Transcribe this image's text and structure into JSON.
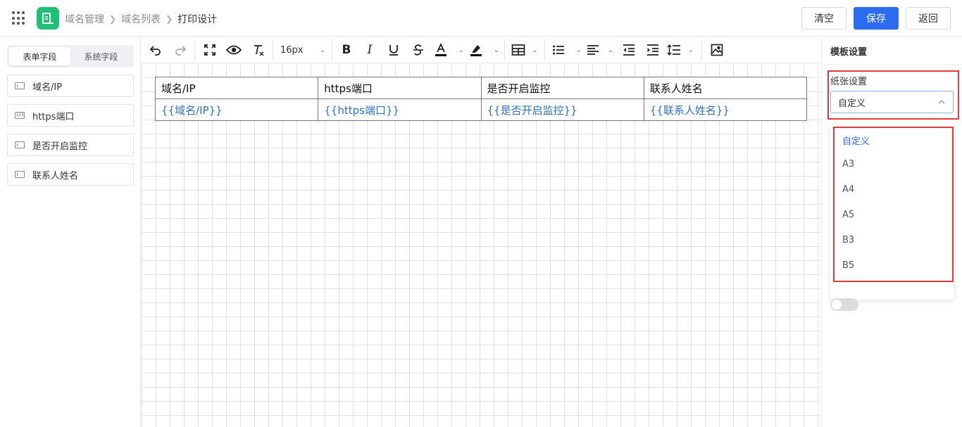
{
  "header": {
    "breadcrumb": [
      "域名管理",
      "域名列表",
      "打印设计"
    ],
    "buttons": {
      "clear": "清空",
      "save": "保存",
      "back": "返回"
    }
  },
  "left_panel": {
    "tabs": [
      "表单字段",
      "系统字段"
    ],
    "active_tab": 0,
    "fields": [
      {
        "label": "域名/IP",
        "icon": "text-field-icon"
      },
      {
        "label": "https端口",
        "icon": "number-field-icon",
        "icon_text": "123"
      },
      {
        "label": "是否开启监控",
        "icon": "text-field-icon"
      },
      {
        "label": "联系人姓名",
        "icon": "text-field-icon"
      }
    ]
  },
  "toolbar": {
    "font_size": "16px",
    "tools": [
      "undo-icon",
      "redo-icon",
      "fullscreen-icon",
      "preview-icon",
      "clear-format-icon",
      "bold-icon",
      "italic-icon",
      "underline-icon",
      "strikethrough-icon",
      "font-color-icon",
      "highlight-icon",
      "table-icon",
      "bullet-list-icon",
      "align-left-icon",
      "outdent-icon",
      "indent-icon",
      "line-height-icon",
      "image-icon"
    ],
    "colors": {
      "font_color": "#000000",
      "highlight": "#000000"
    }
  },
  "canvas": {
    "table": {
      "headers": [
        "域名/IP",
        "https端口",
        "是否开启监控",
        "联系人姓名"
      ],
      "placeholders": [
        "{{域名/IP}}",
        "{{https端口}}",
        "{{是否开启监控}}",
        "{{联系人姓名}}"
      ]
    }
  },
  "right_panel": {
    "title": "模板设置",
    "paper_label": "纸张设置",
    "paper_value": "自定义",
    "paper_options": [
      "自定义",
      "A3",
      "A4",
      "A5",
      "B3",
      "B5"
    ],
    "selected_option": 0
  },
  "colors": {
    "accent": "#2c6cf0",
    "brand_logo": "#1fbf75",
    "highlight_box": "#e23b3b",
    "placeholder_text": "#2f73c9"
  }
}
